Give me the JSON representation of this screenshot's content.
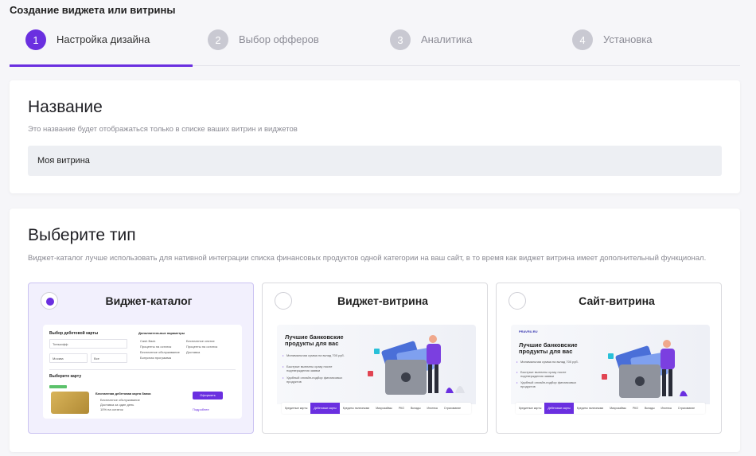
{
  "page": {
    "title": "Создание виджета или витрины"
  },
  "steps": [
    {
      "num": "1",
      "label": "Настройка дизайна",
      "active": true
    },
    {
      "num": "2",
      "label": "Выбор офферов"
    },
    {
      "num": "3",
      "label": "Аналитика"
    },
    {
      "num": "4",
      "label": "Установка"
    }
  ],
  "name_section": {
    "heading": "Название",
    "hint": "Это название будет отображаться только в списке ваших витрин и виджетов",
    "value": "Моя витрина"
  },
  "type_section": {
    "heading": "Выберите тип",
    "hint": "Виджет-каталог лучше использовать для нативной интеграции списка финансовых продуктов одной категории на ваш сайт, в то время как виджет витрина имеет дополнительный функционал.",
    "options": [
      {
        "title": "Виджет-каталог",
        "selected": true
      },
      {
        "title": "Виджет-витрина",
        "selected": false
      },
      {
        "title": "Сайт-витрина",
        "selected": false
      }
    ]
  },
  "catalog_preview": {
    "heading": "Выбор дебетовой карты",
    "extra_params": "Дополнительные параметры",
    "bank_label": "Тинькофф",
    "city_label": "Москва",
    "all_label": "Все",
    "checkboxes": [
      "Cash Back",
      "Проценты на остаток",
      "Бесплатное обслуживание",
      "Бонусная программа",
      "Бесплатное снятие",
      "Проценты на остаток",
      "Доставка"
    ],
    "choose_card": "Выберите карту",
    "card_name": "Бесплатная дебетовая карта банка",
    "card_features": [
      "Бесплатное обслуживание",
      "Доставка за один день",
      "10% на остаток"
    ],
    "apply_button": "Оформить",
    "details_link": "Подробнее"
  },
  "showcase_preview": {
    "logo": "PRAVRU.RU",
    "headline": "Лучшие банковские продукты для вас",
    "bullets": [
      "Минимальная сумма на вклад 700 руб.",
      "Быстрые выплаты сразу после подтверждения заявки",
      "Удобный онлайн-подбор финансовых продуктов"
    ],
    "tabs": [
      "Кредитные карты",
      "Дебетовые карты",
      "Кредиты наличными",
      "Микрозаймы",
      "РКО",
      "Вклады",
      "Ипотека",
      "Страхование"
    ],
    "active_tab": 1
  },
  "colors": {
    "accent": "#6a2fe0",
    "selected_bg": "#f2f0fd",
    "input_bg": "#edeff3"
  }
}
